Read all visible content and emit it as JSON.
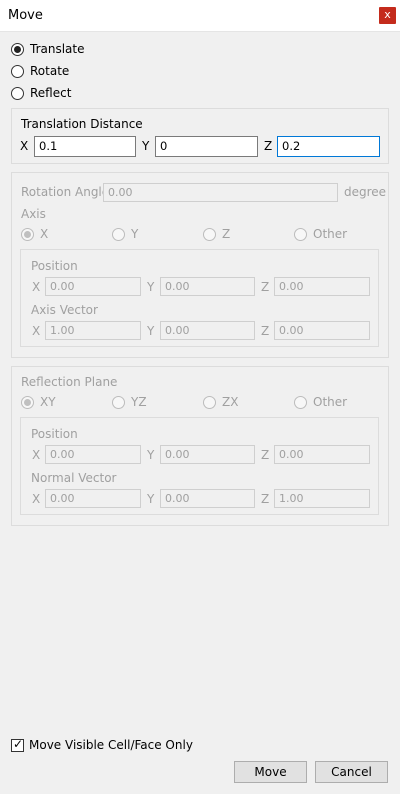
{
  "window": {
    "title": "Move",
    "close_glyph": "x"
  },
  "mode": {
    "translate": "Translate",
    "rotate": "Rotate",
    "reflect": "Reflect",
    "selected": "Translate"
  },
  "translation": {
    "group_label": "Translation Distance",
    "x_label": "X",
    "x_value": "0.1",
    "y_label": "Y",
    "y_value": "0",
    "z_label": "Z",
    "z_value": "0.2"
  },
  "rotation": {
    "angle_label": "Rotation Angle",
    "angle_value": "0.00",
    "angle_unit": "degree",
    "axis_label": "Axis",
    "axis_options": [
      "X",
      "Y",
      "Z",
      "Other"
    ],
    "axis_selected": "X",
    "position_label": "Position",
    "position": {
      "x_label": "X",
      "x": "0.00",
      "y_label": "Y",
      "y": "0.00",
      "z_label": "Z",
      "z": "0.00"
    },
    "vector_label": "Axis Vector",
    "vector": {
      "x_label": "X",
      "x": "1.00",
      "y_label": "Y",
      "y": "0.00",
      "z_label": "Z",
      "z": "0.00"
    }
  },
  "reflection": {
    "plane_label": "Reflection Plane",
    "plane_options": [
      "XY",
      "YZ",
      "ZX",
      "Other"
    ],
    "plane_selected": "XY",
    "position_label": "Position",
    "position": {
      "x_label": "X",
      "x": "0.00",
      "y_label": "Y",
      "y": "0.00",
      "z_label": "Z",
      "z": "0.00"
    },
    "vector_label": "Normal Vector",
    "vector": {
      "x_label": "X",
      "x": "0.00",
      "y_label": "Y",
      "y": "0.00",
      "z_label": "Z",
      "z": "1.00"
    }
  },
  "footer": {
    "visible_only_label": "Move Visible Cell/Face Only",
    "visible_only_checked": true,
    "check_glyph": "✓",
    "move_button": "Move",
    "cancel_button": "Cancel"
  }
}
